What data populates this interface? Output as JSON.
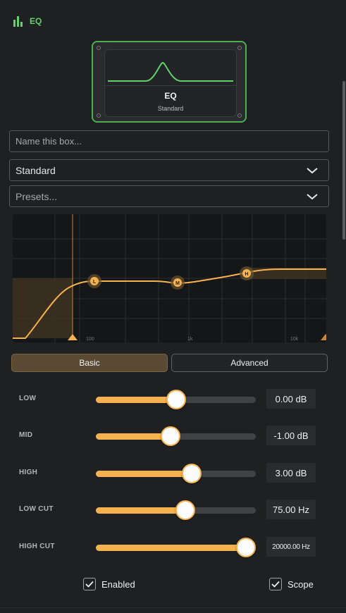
{
  "header": {
    "title": "EQ",
    "icon": "equalizer-bars-icon",
    "accent": "#5fd36a"
  },
  "card": {
    "name": "EQ",
    "preset": "Standard",
    "border_color": "#4caf50"
  },
  "name_field": {
    "placeholder": "Name this box...",
    "value": ""
  },
  "mode_select": {
    "value": "Standard"
  },
  "presets_select": {
    "placeholder": "Presets..."
  },
  "graph": {
    "freq_labels": [
      "100",
      "1k",
      "10k"
    ],
    "bands": [
      {
        "id": "L",
        "label": "L"
      },
      {
        "id": "M",
        "label": "M"
      },
      {
        "id": "H",
        "label": "H"
      }
    ],
    "curve_color": "#f7b250"
  },
  "tabs": [
    {
      "label": "Basic",
      "active": true
    },
    {
      "label": "Advanced",
      "active": false
    }
  ],
  "sliders": [
    {
      "label": "LOW",
      "value": "0.00 dB",
      "fraction": 0.5
    },
    {
      "label": "MID",
      "value": "-1.00 dB",
      "fraction": 0.465
    },
    {
      "label": "HIGH",
      "value": "3.00 dB",
      "fraction": 0.6
    },
    {
      "label": "LOW CUT",
      "value": "75.00 Hz",
      "fraction": 0.56
    },
    {
      "label": "HIGH CUT",
      "value": "20000.00 Hz",
      "fraction": 0.94
    }
  ],
  "checkboxes": [
    {
      "label": "Enabled",
      "checked": true
    },
    {
      "label": "Scope",
      "checked": true
    }
  ],
  "colors": {
    "accent": "#f7b250",
    "background": "#1f2022"
  }
}
